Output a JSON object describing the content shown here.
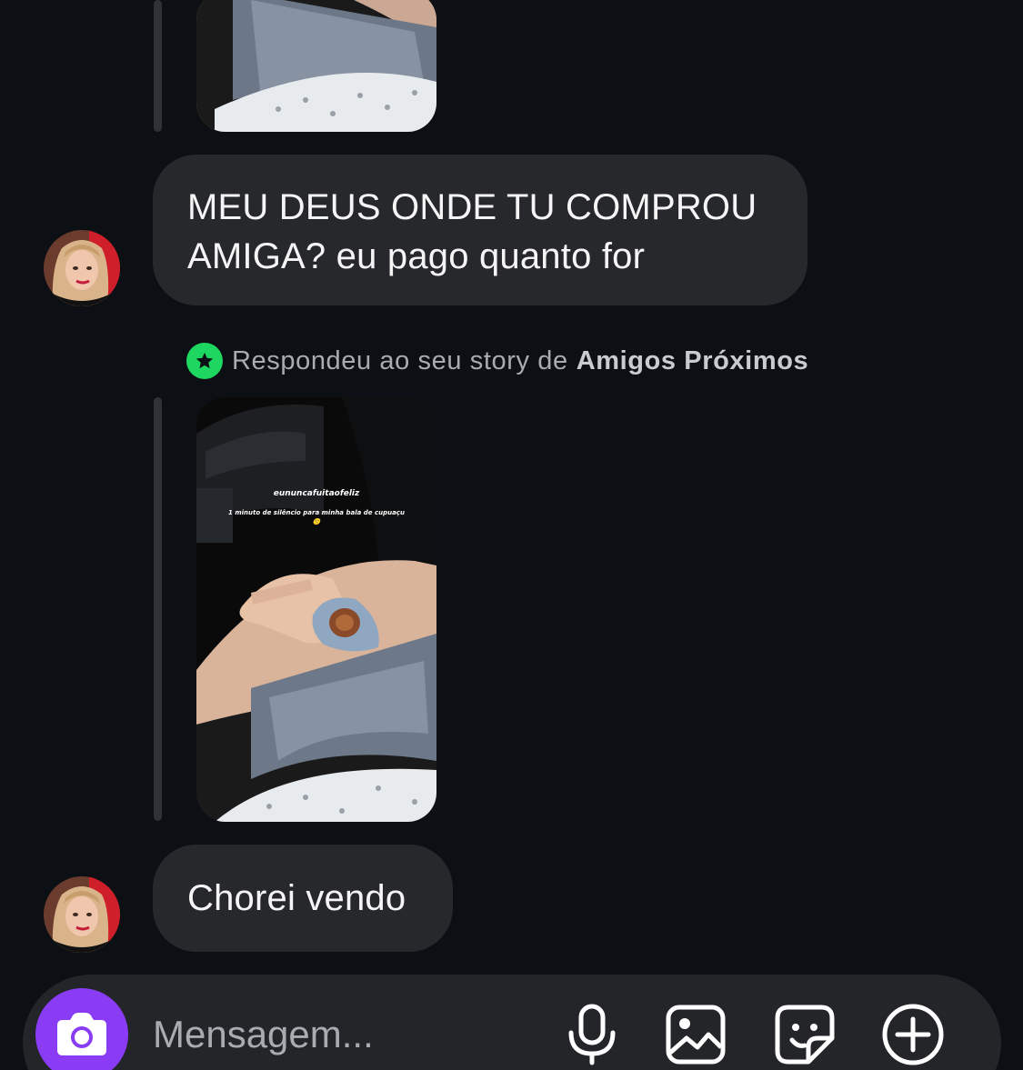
{
  "messages": {
    "message_1": "MEU DEUS ONDE TU COMPROU AMIGA? eu pago quanto for",
    "message_2": "Chorei vendo"
  },
  "story_reply": {
    "prefix": "Respondeu ao seu story de",
    "list_name": "Amigos Próximos",
    "badge_icon": "star-icon",
    "badge_color": "#1ed760",
    "overlay_username": "eununcafuitaofeliz",
    "overlay_caption": "1 minuto de silêncio para minha bala de cupuaçu 🙁"
  },
  "composer": {
    "placeholder": "Mensagem...",
    "camera_icon": "camera-icon",
    "camera_color": "#8a3cf5",
    "icons": [
      "microphone-icon",
      "gallery-icon",
      "sticker-icon",
      "add-icon"
    ]
  }
}
